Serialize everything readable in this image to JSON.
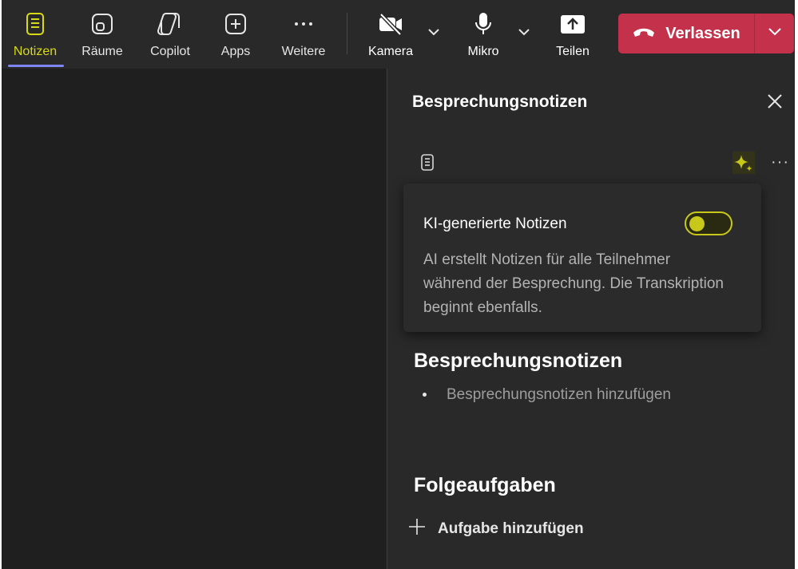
{
  "toolbar": {
    "items": [
      {
        "label": "Notizen",
        "icon": "notes-icon"
      },
      {
        "label": "Räume",
        "icon": "rooms-icon"
      },
      {
        "label": "Copilot",
        "icon": "copilot-icon"
      },
      {
        "label": "Apps",
        "icon": "apps-icon"
      },
      {
        "label": "Weitere",
        "icon": "more-icon"
      },
      {
        "label": "Kamera",
        "icon": "camera-off-icon"
      },
      {
        "label": "Mikro",
        "icon": "microphone-icon"
      },
      {
        "label": "Teilen",
        "icon": "share-icon"
      }
    ],
    "leave_label": "Verlassen",
    "colors": {
      "active": "#d8da15",
      "leave": "#c4314b",
      "indicator": "#7f85f5"
    }
  },
  "panel": {
    "title": "Besprechungsnotizen",
    "card": {
      "title": "KI-generierte Notizen",
      "description": "AI erstellt Notizen für alle Teilnehmer während der Besprechung. Die Transkription beginnt ebenfalls.",
      "toggle_on": false
    },
    "notes_heading": "Besprechungsnotizen",
    "notes_placeholder": "Besprechungsnotizen hinzufügen",
    "tasks_heading": "Folgeaufgaben",
    "add_task_label": "Aufgabe hinzufügen"
  }
}
